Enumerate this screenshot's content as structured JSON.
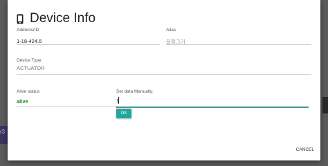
{
  "dialog": {
    "title": "Device Info",
    "title_icon": "mobile-phone-icon"
  },
  "fields": {
    "address": {
      "label": "Address/ID",
      "value": "1-18-424.6"
    },
    "alias": {
      "label": "Alias",
      "value": "끌정그기"
    },
    "device_type": {
      "label": "Device Type",
      "value": "ACTUATOR"
    },
    "alive_status": {
      "label": "Alive status",
      "value": "alive"
    },
    "manual_data": {
      "label": "Set data Manually:",
      "value": "1"
    }
  },
  "buttons": {
    "ok_label": "OK",
    "cancel_label": "CANCEL"
  },
  "backdrop": {
    "left_text": "r3"
  },
  "colors": {
    "accent": "#26a69a",
    "alive": "#2e7d32",
    "overlay": "#5c5c5c"
  }
}
